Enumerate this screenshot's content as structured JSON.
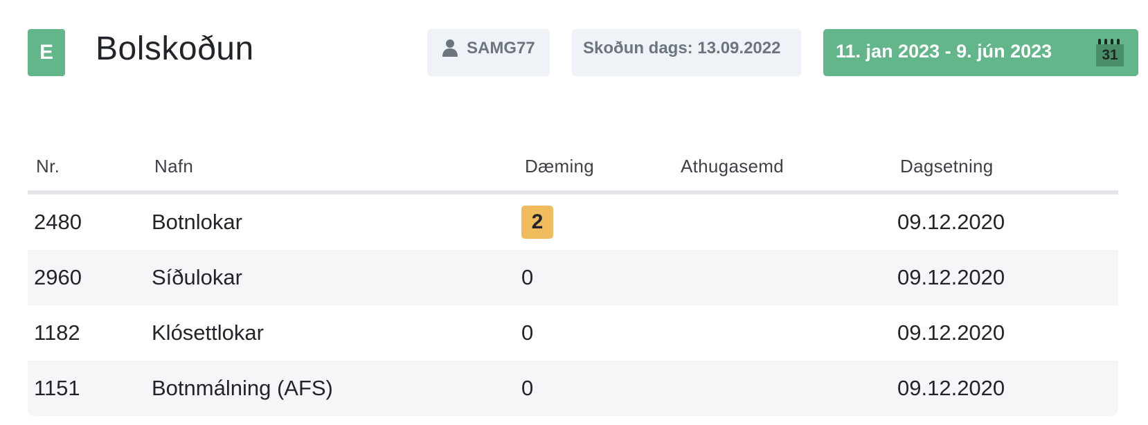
{
  "header": {
    "logo_letter": "E",
    "title": "Bolskoðun",
    "user": "SAMG77",
    "user_icon": "user-icon",
    "inspection_date": "Skoðun dags: 13.09.2022",
    "date_range": "11. jan 2023 - 9. jún 2023",
    "calendar_icon": "calendar-icon",
    "calendar_day": "31",
    "accent_color": "#62b68a"
  },
  "table": {
    "columns": {
      "nr": "Nr.",
      "name": "Nafn",
      "rating": "Dæming",
      "comment": "Athugasemd",
      "date": "Dagsetning"
    },
    "rows": [
      {
        "nr": "2480",
        "name": "Botnlokar",
        "rating": "2",
        "comment": "",
        "date": "09.12.2020",
        "rating_highlight": true
      },
      {
        "nr": "2960",
        "name": "Síðulokar",
        "rating": "0",
        "comment": "",
        "date": "09.12.2020",
        "rating_highlight": false
      },
      {
        "nr": "1182",
        "name": "Klósettlokar",
        "rating": "0",
        "comment": "",
        "date": "09.12.2020",
        "rating_highlight": false
      },
      {
        "nr": "1151",
        "name": "Botnmálning (AFS)",
        "rating": "0",
        "comment": "",
        "date": "09.12.2020",
        "rating_highlight": false
      }
    ],
    "highlight_color": "#f0bc5e"
  }
}
